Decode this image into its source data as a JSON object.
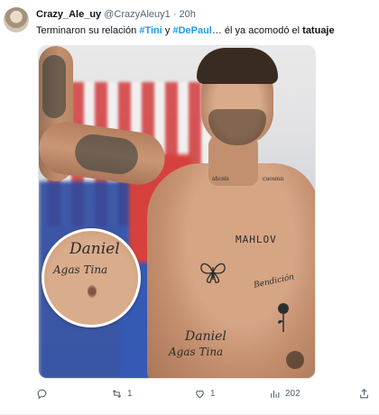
{
  "tweet": {
    "author_name": "Crazy_Ale_uy",
    "handle": "@CrazyAleuy1",
    "separator": "·",
    "time": "20h",
    "text_parts": {
      "t1": "Terminaron su relación ",
      "h1": "#Tini",
      "t2": " y ",
      "h2": "#DePaul",
      "t3": "… él ya acomodó el ",
      "b1": "tatuaje"
    }
  },
  "image": {
    "tattoos": {
      "neck_left": "ahcsis",
      "neck_right": "cuosmn",
      "chest": "MAHLOV",
      "rib_script": "Bendición",
      "abdomen_name": "Daniel",
      "abdomen_sub": "Agas Tina",
      "zoom_name": "Daniel",
      "zoom_sub": "Agas Tina"
    }
  },
  "actions": {
    "replies": "",
    "retweets": "1",
    "likes": "1",
    "views": "202"
  },
  "colors": {
    "hashtag": "#1d9bf0",
    "secondary": "#536471"
  },
  "icons": [
    "reply-icon",
    "retweet-icon",
    "like-icon",
    "views-icon",
    "share-icon",
    "expand-icon"
  ]
}
